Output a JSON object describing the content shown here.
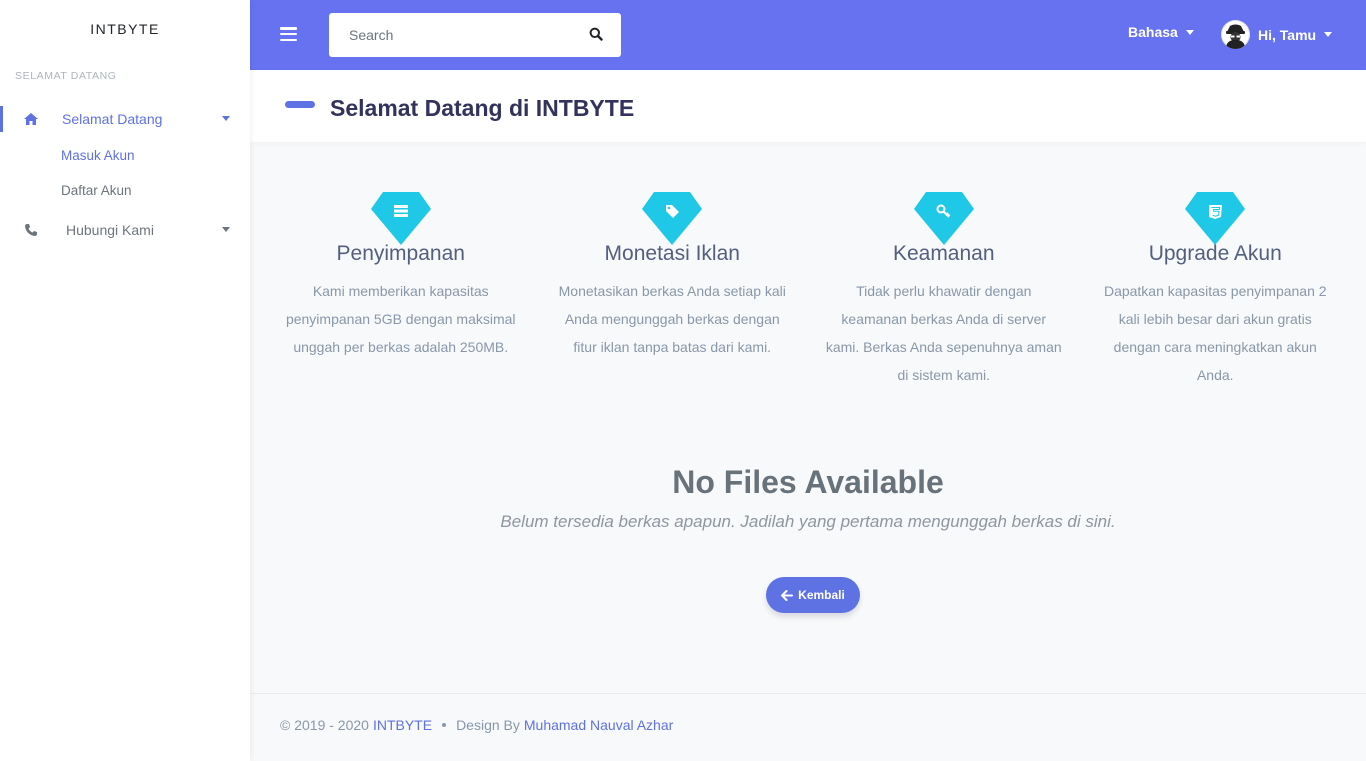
{
  "brand": "INTBYTE",
  "sidebar": {
    "heading": "SELAMAT DATANG",
    "items": [
      {
        "label": "Selamat Datang",
        "icon": "home-icon",
        "active": true,
        "children": [
          {
            "label": "Masuk Akun",
            "current": true
          },
          {
            "label": "Daftar Akun",
            "current": false
          }
        ]
      },
      {
        "label": "Hubungi Kami",
        "icon": "phone-icon",
        "active": false
      }
    ]
  },
  "topbar": {
    "search_placeholder": "Search",
    "language_label": "Bahasa",
    "user_greeting": "Hi, Tamu",
    "bg_color": "#6672f0"
  },
  "page": {
    "title": "Selamat Datang di INTBYTE"
  },
  "features": [
    {
      "title": "Penyimpanan",
      "icon": "server-icon",
      "text": "Kami memberikan kapasitas penyimpanan 5GB dengan maksimal unggah per berkas adalah 250MB."
    },
    {
      "title": "Monetasi Iklan",
      "icon": "tags-icon",
      "text": "Monetasikan berkas Anda setiap kali Anda mengunggah berkas dengan fitur iklan tanpa batas dari kami."
    },
    {
      "title": "Keamanan",
      "icon": "key-icon",
      "text": "Tidak perlu khawatir dengan keamanan berkas Anda di server kami. Berkas Anda sepenuhnya aman di sistem kami."
    },
    {
      "title": "Upgrade Akun",
      "icon": "css3-icon",
      "text": "Dapatkan kapasitas penyimpanan 2 kali lebih besar dari akun gratis dengan cara meningkatkan akun Anda."
    }
  ],
  "empty_state": {
    "title": "No Files Available",
    "subtitle": "Belum tersedia berkas apapun. Jadilah yang pertama mengunggah berkas di sini.",
    "button_label": "Kembali"
  },
  "footer": {
    "copyright": "© 2019 - 2020",
    "brand_link": "INTBYTE",
    "design_by": "Design By",
    "author_link": "Muhamad Nauval Azhar"
  },
  "colors": {
    "accent": "#5e72e4",
    "feature_icon": "#1ec8e6"
  }
}
